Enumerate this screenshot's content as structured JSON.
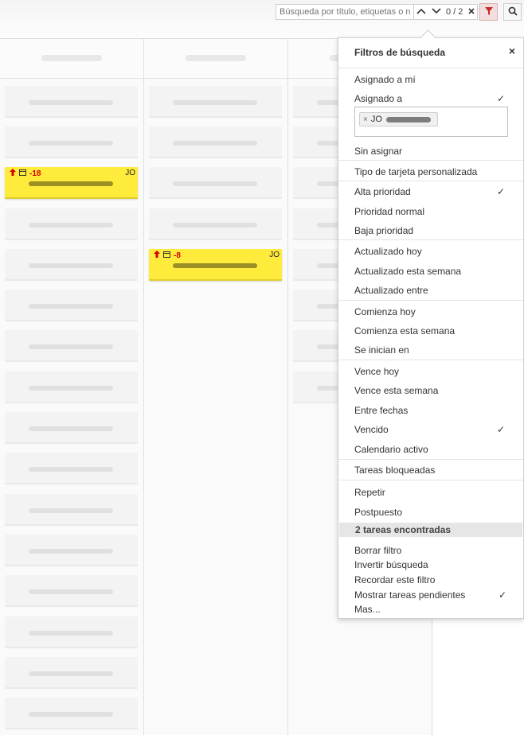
{
  "toolbar": {
    "search_placeholder": "Búsqueda por título, etiquetas o nc",
    "match_count": "0 / 2",
    "icons": [
      "chevron-up-icon",
      "chevron-down-icon",
      "close-icon",
      "filter-icon",
      "search-icon"
    ]
  },
  "cards": {
    "col1_yellow": {
      "days": "-18",
      "initials": "JO"
    },
    "col2_yellow": {
      "days": "-8",
      "initials": "JO"
    }
  },
  "filters": {
    "title": "Filtros de búsqueda",
    "close": "×",
    "assigned_to_me": "Asignado a mí",
    "assigned_to": "Asignado a",
    "assignee_chip": {
      "remove": "×",
      "initials": "JO"
    },
    "unassigned": "Sin asignar",
    "custom_card_type": "Tipo de tarjeta personalizada",
    "high_priority": "Alta prioridad",
    "normal_priority": "Prioridad normal",
    "low_priority": "Baja prioridad",
    "updated_today": "Actualizado hoy",
    "updated_this_week": "Actualizado esta semana",
    "updated_between": "Actualizado entre",
    "starts_today": "Comienza hoy",
    "starts_this_week": "Comienza esta semana",
    "starts_in": "Se inician en",
    "due_today": "Vence hoy",
    "due_this_week": "Vence esta semana",
    "between_dates": "Entre fechas",
    "overdue": "Vencido",
    "active_calendar": "Calendario activo",
    "blocked_tasks": "Tareas bloqueadas",
    "repeat": "Repetir",
    "postponed": "Postpuesto",
    "found": "2 tareas encontradas",
    "clear_filter": "Borrar filtro",
    "invert_search": "Invertir búsqueda",
    "remember_filter": "Recordar este filtro",
    "show_pending": "Mostrar tareas pendientes",
    "more": "Mas...",
    "checkmark": "✓"
  },
  "colors": {
    "card_yellow": "#ffeb3b",
    "overdue_red": "#d50000",
    "filter_active_bg": "#f2dede"
  }
}
